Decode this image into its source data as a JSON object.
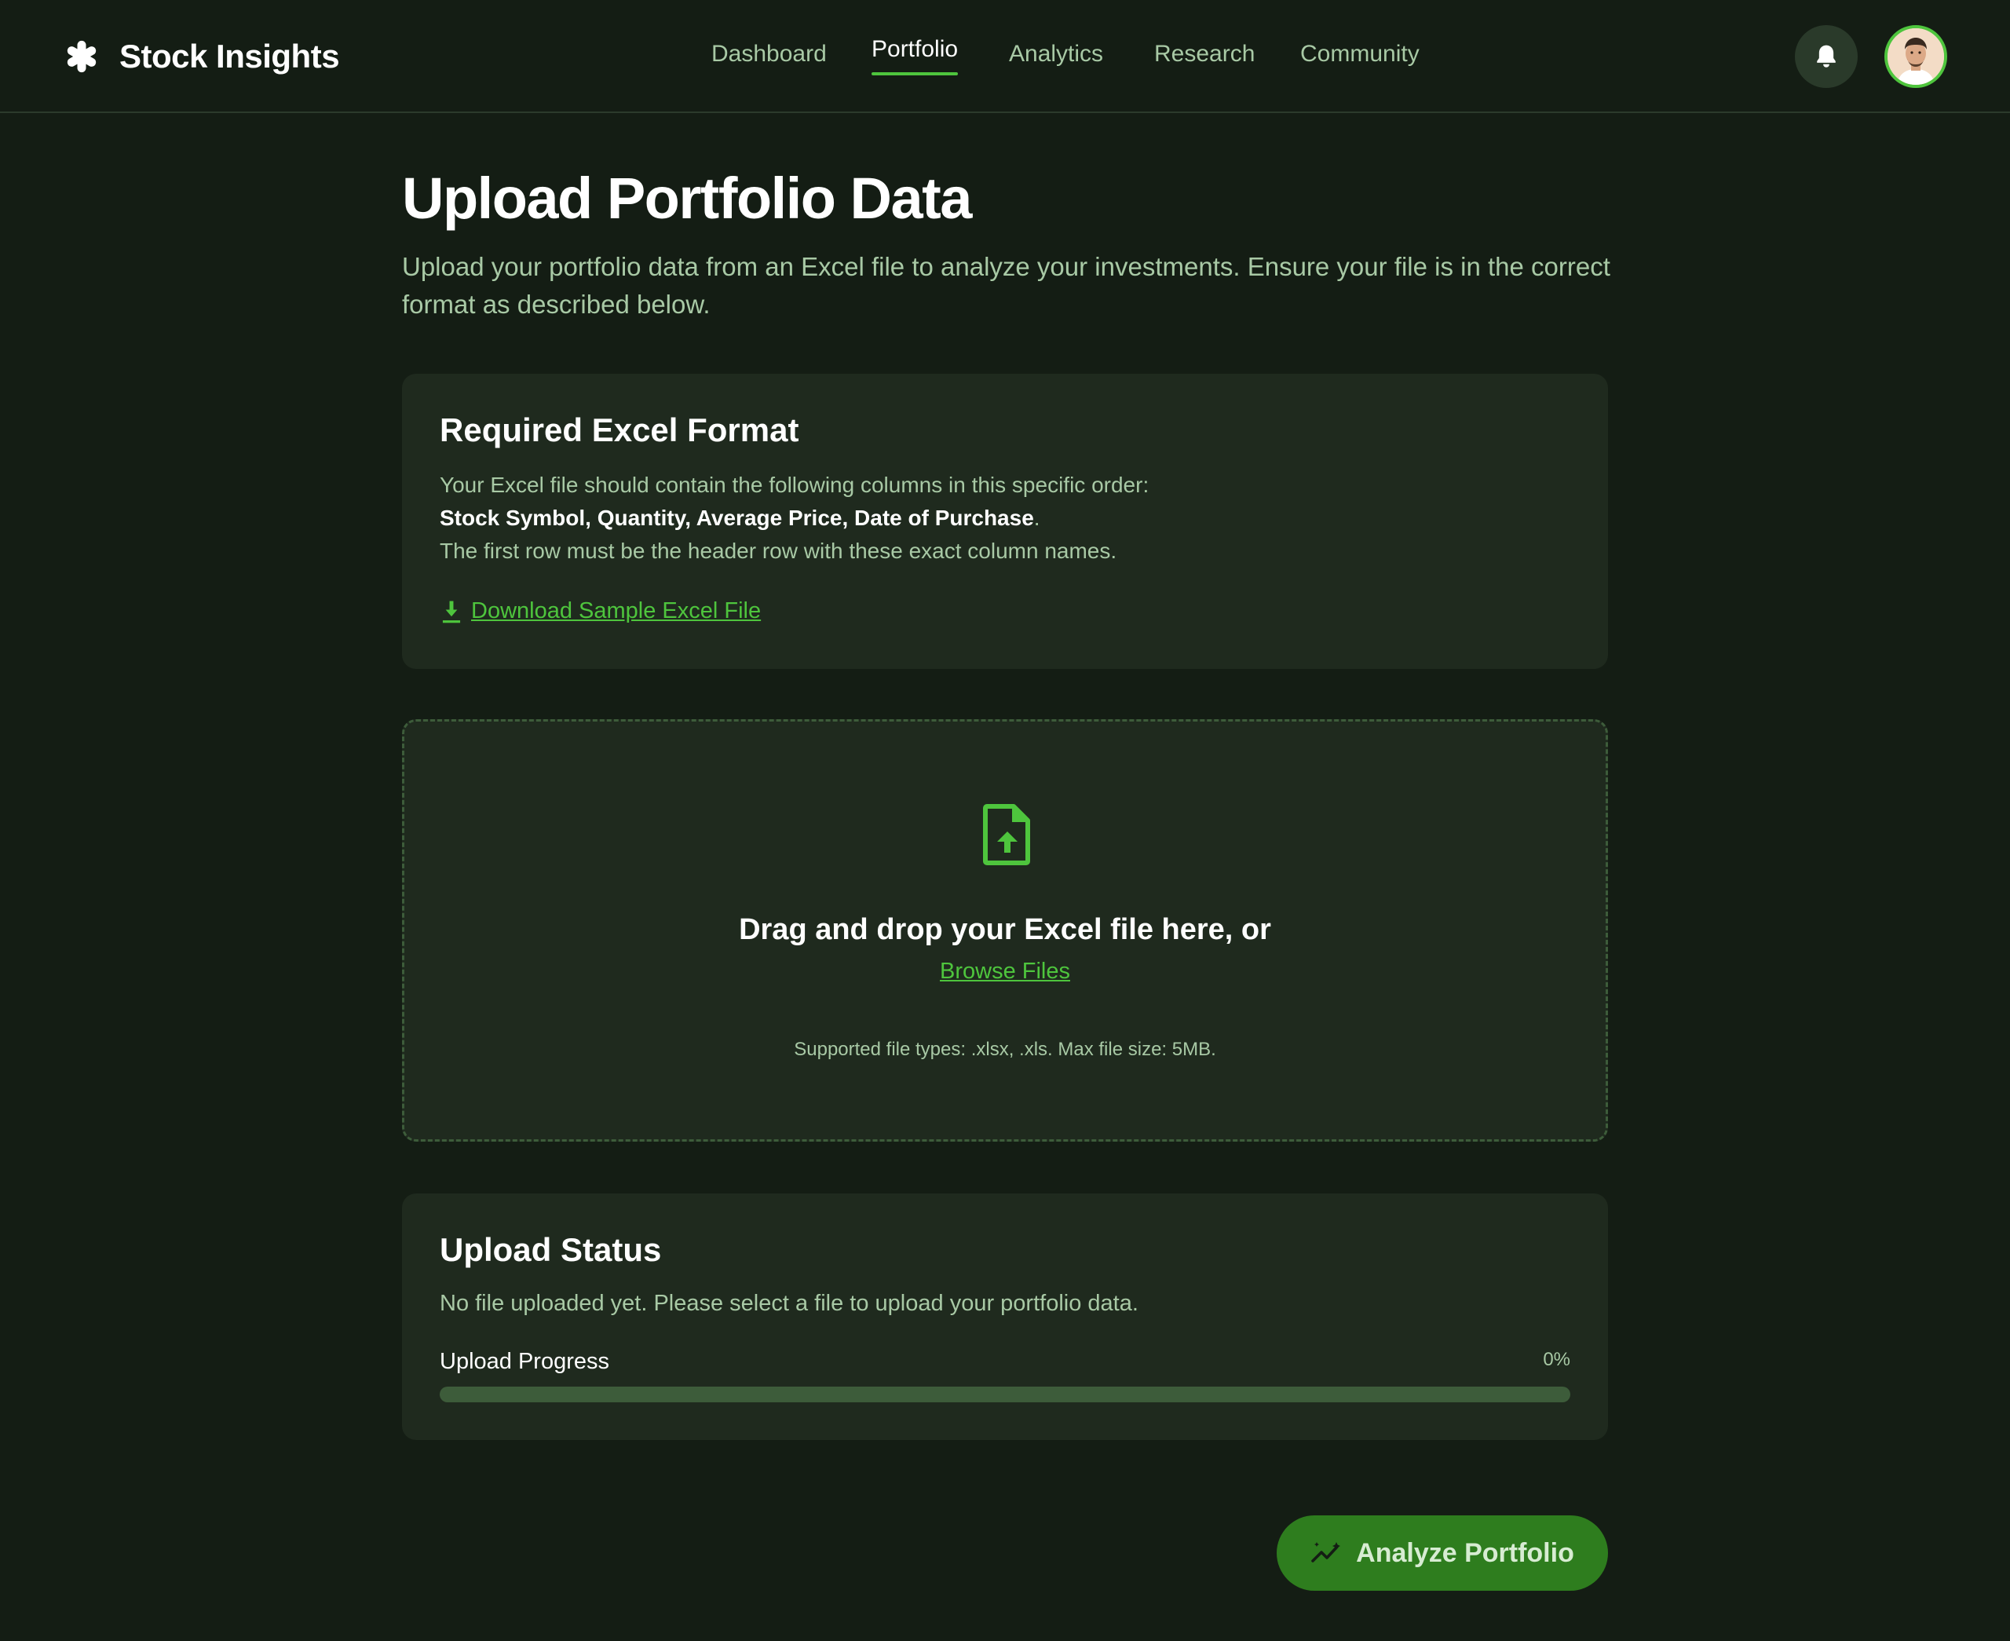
{
  "app": {
    "name": "Stock Insights"
  },
  "nav": {
    "items": [
      {
        "label": "Dashboard",
        "active": false
      },
      {
        "label": "Portfolio",
        "active": true
      },
      {
        "label": "Analytics",
        "active": false
      },
      {
        "label": "Research",
        "active": false
      },
      {
        "label": "Community",
        "active": false
      }
    ]
  },
  "header": {
    "notification_icon": "bell-icon",
    "avatar_icon": "user-avatar"
  },
  "page": {
    "title": "Upload Portfolio Data",
    "subtitle": "Upload your portfolio data from an Excel file to analyze your investments. Ensure your file is in the correct format as described below."
  },
  "format_card": {
    "title": "Required Excel Format",
    "line1": "Your Excel file should contain the following columns in this specific order:",
    "columns": "Stock Symbol, Quantity, Average Price, Date of Purchase",
    "line3": "The first row must be the header row with these exact column names.",
    "download_label": "Download Sample Excel File",
    "download_icon": "download-icon"
  },
  "dropzone": {
    "icon": "file-upload-icon",
    "title": "Drag and drop your Excel file here, or",
    "browse_label": "Browse Files",
    "hint": "Supported file types: .xlsx, .xls. Max file size: 5MB."
  },
  "status_card": {
    "title": "Upload Status",
    "message": "No file uploaded yet. Please select a file to upload your portfolio data.",
    "progress_label": "Upload Progress",
    "progress_text": "0%",
    "progress_value": 0
  },
  "actions": {
    "analyze_label": "Analyze Portfolio",
    "analyze_icon": "trend-sparkle-icon"
  },
  "colors": {
    "background": "#141d14",
    "card": "#1f2a1e",
    "accent": "#4ec53d",
    "muted_text": "#a8c9a5",
    "button": "#2e7d1e"
  }
}
